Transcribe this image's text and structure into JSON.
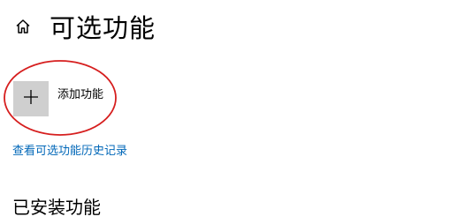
{
  "header": {
    "home_icon": "home-icon",
    "title": "可选功能"
  },
  "add_feature": {
    "icon": "plus-icon",
    "label": "添加功能"
  },
  "history_link": "查看可选功能历史记录",
  "installed_section": {
    "title": "已安装功能"
  },
  "colors": {
    "link": "#0067b8",
    "annotation": "#d61e1e",
    "tile": "#cfcfcf"
  }
}
